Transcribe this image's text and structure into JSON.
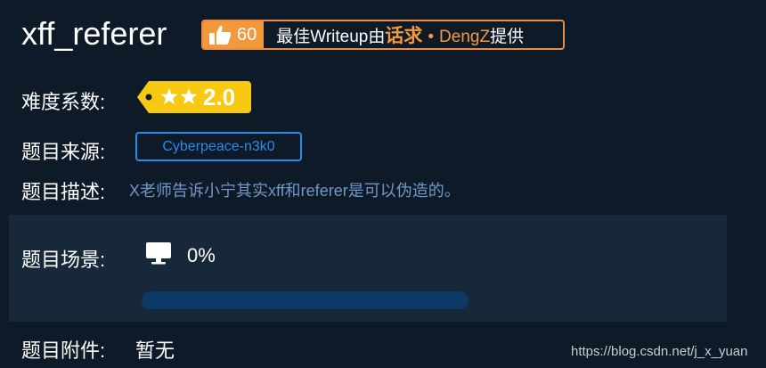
{
  "title": "xff_referer",
  "badge": {
    "likes": "60",
    "prefix": "最佳Writeup由",
    "highlight": "话求",
    "dot": "•",
    "author": "DengZ",
    "suffix": "提供"
  },
  "difficulty": {
    "label": "难度系数:",
    "value": "2.0",
    "stars": 2
  },
  "source": {
    "label": "题目来源:",
    "value": "Cyberpeace-n3k0"
  },
  "description": {
    "label": "题目描述:",
    "value": "X老师告诉小宁其实xff和referer是可以伪造的。"
  },
  "scene": {
    "label": "题目场景:",
    "percent_text": "0%",
    "progress": 0
  },
  "attachment": {
    "label": "题目附件:",
    "value": "暂无"
  },
  "watermark": "https://blog.csdn.net/j_x_yuan",
  "colors": {
    "background": "#0f1a28",
    "accent_orange": "#f29a3b",
    "accent_blue": "#2b8be6",
    "tag_yellow": "#f7c911"
  }
}
